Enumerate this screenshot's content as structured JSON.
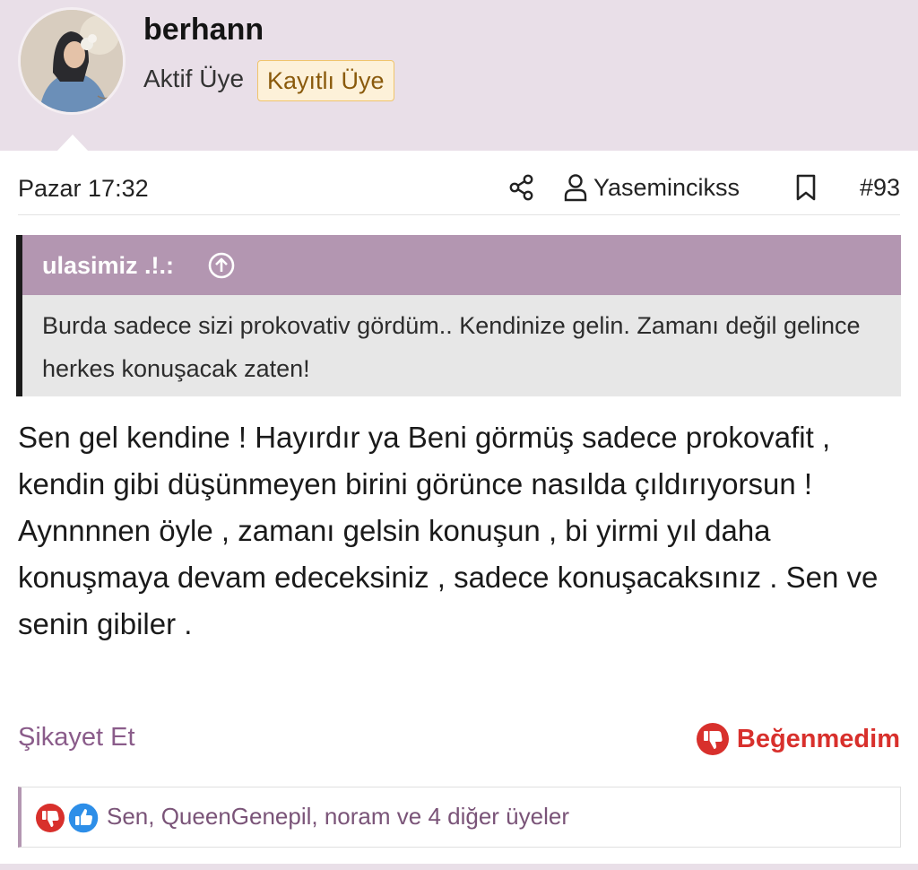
{
  "user": {
    "name": "berhann",
    "title": "Aktif Üye",
    "badge": "Kayıtlı Üye"
  },
  "post": {
    "date": "Pazar 17:32",
    "author": "Yasemincikss",
    "number": "#93"
  },
  "quote": {
    "author": "ulasimiz .!.:",
    "text": "Burda sadece sizi prokovativ gördüm.. Kendinize gelin. Zamanı değil gelince herkes konuşacak zaten!"
  },
  "body": "Sen gel kendine ! Hayırdır ya Beni görmüş sadece prokovafit , kendin gibi düşünmeyen birini görünce nasılda çıldırıyorsun !\nAynnnnen öyle , zamanı gelsin konuşun , bi yirmi yıl daha konuşmaya devam edeceksiniz , sadece konuşacaksınız . Sen ve senin gibiler .",
  "actions": {
    "report": "Şikayet Et",
    "dislike": "Beğenmedim"
  },
  "reactions": {
    "text": "Sen, QueenGenepil, noram ve 4 diğer üyeler"
  },
  "colors": {
    "header_bg": "#e9dfe8",
    "quote_head": "#b396b1",
    "dislike": "#d8302c",
    "like": "#2d8ee8",
    "badge_bg": "#fdf1d9",
    "badge_text": "#8a5a0c"
  },
  "icons": {
    "share": "share-icon",
    "author": "user-icon",
    "bookmark": "bookmark-icon",
    "quote_jump": "arrow-up-circle-icon",
    "dislike": "thumbs-down-icon",
    "like": "thumbs-up-icon"
  }
}
